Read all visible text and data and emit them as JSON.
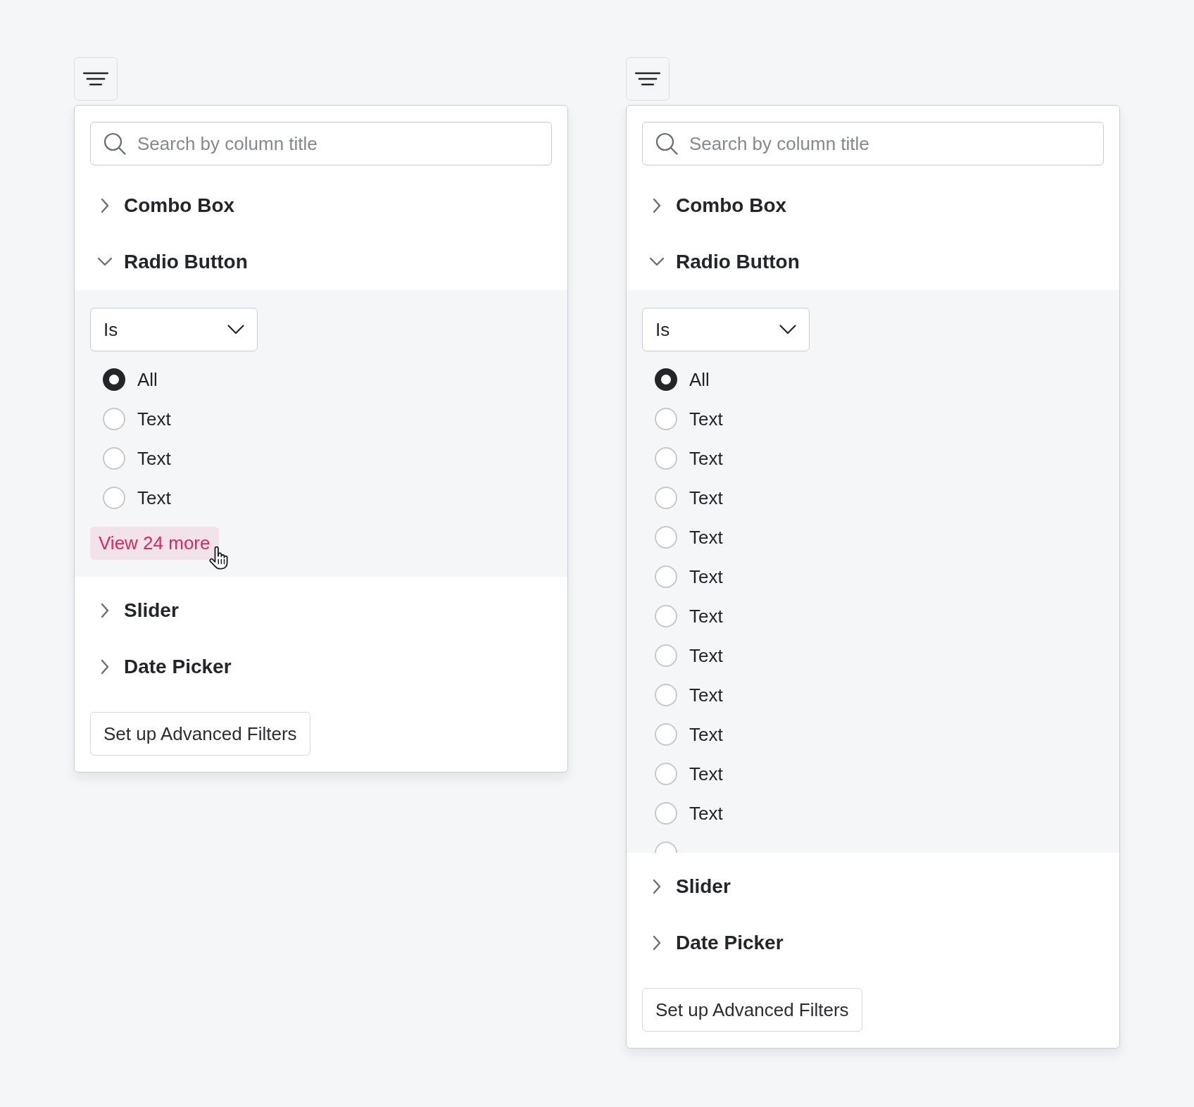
{
  "panels": [
    {
      "search": {
        "placeholder": "Search by column title"
      },
      "sections": [
        {
          "title": "Combo Box",
          "expanded": false
        },
        {
          "title": "Radio Button",
          "expanded": true,
          "operator": "Is",
          "options": [
            {
              "label": "All",
              "selected": true
            },
            {
              "label": "Text",
              "selected": false
            },
            {
              "label": "Text",
              "selected": false
            },
            {
              "label": "Text",
              "selected": false
            }
          ],
          "view_more": {
            "label": "View 24 more",
            "hovered": true
          }
        },
        {
          "title": "Slider",
          "expanded": false
        },
        {
          "title": "Date Picker",
          "expanded": false
        }
      ],
      "footer_button": "Set up Advanced Filters"
    },
    {
      "search": {
        "placeholder": "Search by column title"
      },
      "sections": [
        {
          "title": "Combo Box",
          "expanded": false
        },
        {
          "title": "Radio Button",
          "expanded": true,
          "operator": "Is",
          "options": [
            {
              "label": "All",
              "selected": true
            },
            {
              "label": "Text",
              "selected": false
            },
            {
              "label": "Text",
              "selected": false
            },
            {
              "label": "Text",
              "selected": false
            },
            {
              "label": "Text",
              "selected": false
            },
            {
              "label": "Text",
              "selected": false
            },
            {
              "label": "Text",
              "selected": false
            },
            {
              "label": "Text",
              "selected": false
            },
            {
              "label": "Text",
              "selected": false
            },
            {
              "label": "Text",
              "selected": false
            },
            {
              "label": "Text",
              "selected": false
            },
            {
              "label": "Text",
              "selected": false
            },
            {
              "selected": false
            }
          ]
        },
        {
          "title": "Slider",
          "expanded": false
        },
        {
          "title": "Date Picker",
          "expanded": false
        }
      ],
      "footer_button": "Set up Advanced Filters"
    }
  ]
}
